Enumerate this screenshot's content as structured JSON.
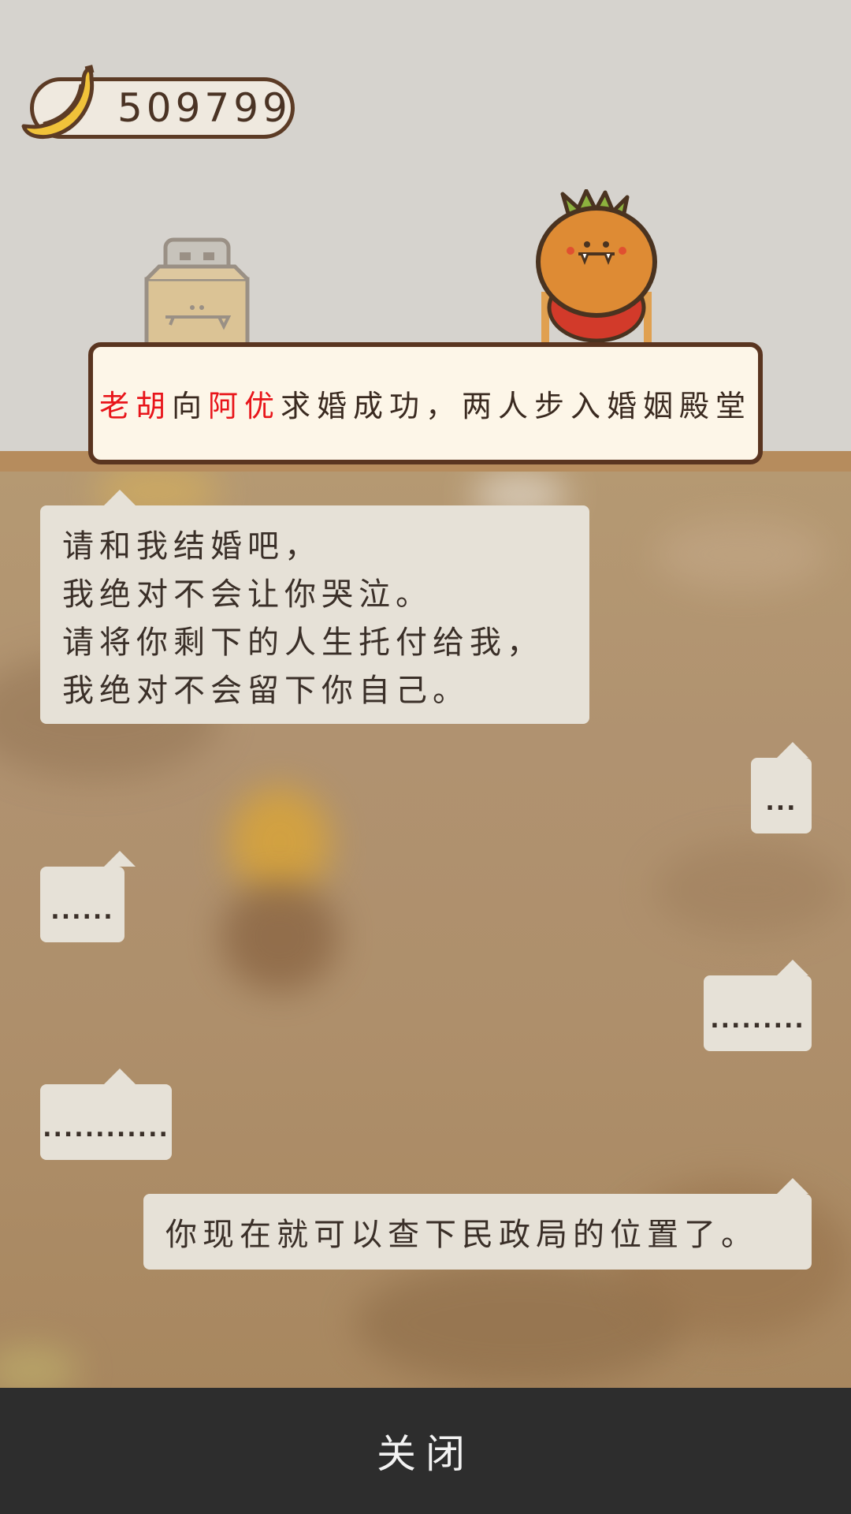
{
  "currency": {
    "icon": "banana-icon",
    "amount": "509799"
  },
  "banner": {
    "name1": "老胡",
    "part1": "向",
    "name2": "阿优",
    "part2": "求婚成功，两人步入婚姻殿堂",
    "highlight_color": "#e8151a"
  },
  "chat": {
    "proposal_lines": [
      "请和我结婚吧，",
      "我绝对不会让你哭泣。",
      "请将你剩下的人生托付给我，",
      "我绝对不会留下你自己。"
    ],
    "reply1": "...",
    "reply2": "......",
    "reply3": ".........",
    "reply4": "............",
    "final": "你现在就可以查下民政局的位置了。"
  },
  "bottom_bar": {
    "close_label": "关闭"
  }
}
